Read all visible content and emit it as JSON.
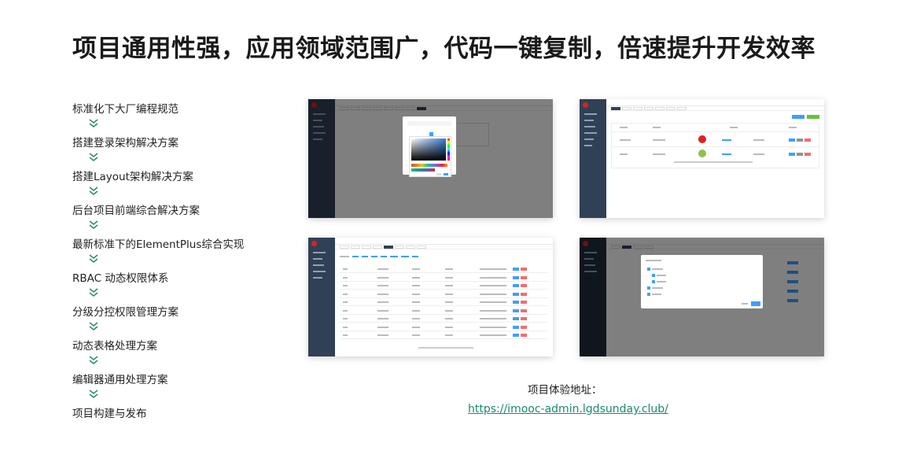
{
  "title": "项目通用性强，应用领域范围广，代码一键复制，倍速提升开发效率",
  "steps": [
    "标准化下大厂编程规范",
    "搭建登录架构解决方案",
    "搭建Layout架构解决方案",
    "后台项目前端综合解决方案",
    "最新标准下的ElementPlus综合实现",
    "RBAC 动态权限体系",
    "分级分控权限管理方案",
    "动态表格处理方案",
    "编辑器通用处理方案",
    "项目构建与发布"
  ],
  "arrow_icon": "double-chevron-down-icon",
  "arrow_color": "#2e8b74",
  "experience_label": "项目体验地址：",
  "experience_url": "https://imooc-admin.lgdsunday.club/",
  "link_color": "#1a8a6e",
  "sidebar_color": "#304156",
  "thumbnails": [
    "theme-color-picker-screenshot",
    "user-list-screenshot",
    "dynamic-table-screenshot",
    "permission-dialog-screenshot"
  ]
}
